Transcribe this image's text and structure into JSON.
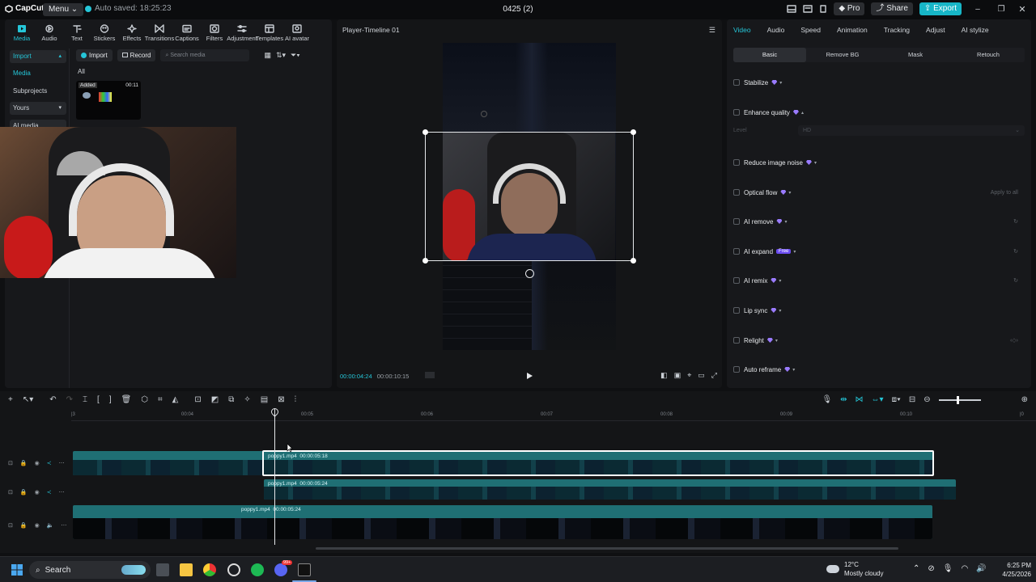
{
  "window": {
    "app_name": "CapCut",
    "menu_label": "Menu",
    "autosave_text": "Auto saved: 18:25:23",
    "project_title": "0425 (2)",
    "pro_label": "Pro",
    "share_label": "Share",
    "export_label": "Export"
  },
  "toolbar": {
    "tabs": [
      {
        "label": "Media",
        "icon": "media-icon"
      },
      {
        "label": "Audio",
        "icon": "audio-icon"
      },
      {
        "label": "Text",
        "icon": "text-icon"
      },
      {
        "label": "Stickers",
        "icon": "stickers-icon"
      },
      {
        "label": "Effects",
        "icon": "effects-icon"
      },
      {
        "label": "Transitions",
        "icon": "transitions-icon"
      },
      {
        "label": "Captions",
        "icon": "captions-icon"
      },
      {
        "label": "Filters",
        "icon": "filters-icon"
      },
      {
        "label": "Adjustment",
        "icon": "adjustment-icon"
      },
      {
        "label": "Templates",
        "icon": "templates-icon"
      },
      {
        "label": "AI avatar",
        "icon": "ai-avatar-icon"
      }
    ]
  },
  "sidebar": {
    "items": [
      "Import",
      "Media",
      "Subprojects",
      "Yours",
      "AI media"
    ]
  },
  "media": {
    "import_label": "Import",
    "record_label": "Record",
    "search_placeholder": "Search media",
    "filter_label": "All",
    "thumb_badge": "Added",
    "thumb_duration": "00:11"
  },
  "player": {
    "title": "Player-Timeline 01",
    "current_time": "00:00:04:24",
    "total_time": "00:00:10:15"
  },
  "inspector": {
    "tabs": [
      "Video",
      "Audio",
      "Speed",
      "Animation",
      "Tracking",
      "Adjust",
      "AI stylize"
    ],
    "sub_tabs": [
      "Basic",
      "Remove BG",
      "Mask",
      "Retouch"
    ],
    "options": [
      "Stabilize",
      "Enhance quality",
      "Reduce image noise",
      "Optical flow",
      "AI remove",
      "AI expand",
      "AI remix",
      "Lip sync",
      "Relight",
      "Auto reframe"
    ],
    "level_label": "Level",
    "level_value": "HD",
    "apply_all_label": "Apply to all",
    "free_badge": "Free"
  },
  "timeline": {
    "ruler": [
      "00:04",
      "00:05",
      "00:06",
      "00:07",
      "00:08",
      "00:09",
      "00:10"
    ],
    "clips": [
      {
        "name": "poppy1.mp4",
        "duration": "00:00:05:18"
      },
      {
        "name": "poppy1.mp4",
        "duration": "00:00:05:24"
      },
      {
        "name": "poppy1.mp4",
        "duration": "00:00:05:24"
      }
    ]
  },
  "taskbar": {
    "search_label": "Search",
    "weather_temp": "12°C",
    "weather_desc": "Mostly cloudy",
    "time": "6:25 PM",
    "date": "4/25/2026",
    "discord_badge": "99+"
  }
}
